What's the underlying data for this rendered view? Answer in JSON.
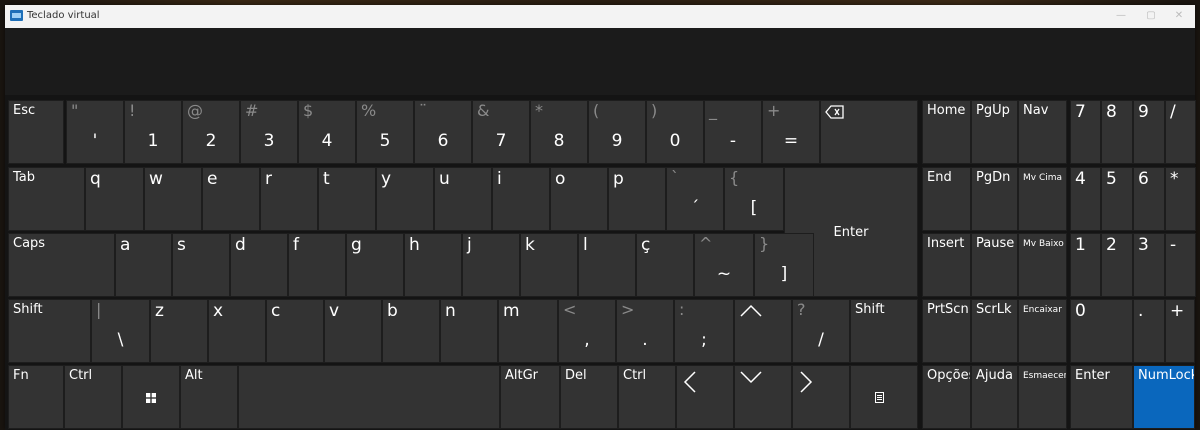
{
  "window": {
    "title": "Teclado virtual",
    "controls": [
      "—",
      "▢",
      "✕"
    ]
  },
  "main_keys": [
    {
      "name": "key-esc",
      "p": "Esc"
    },
    {
      "name": "key-quote",
      "s": "\"",
      "m": "'"
    },
    {
      "name": "key-1",
      "s": "!",
      "m": "1"
    },
    {
      "name": "key-2",
      "s": "@",
      "m": "2"
    },
    {
      "name": "key-3",
      "s": "#",
      "m": "3"
    },
    {
      "name": "key-4",
      "s": "$",
      "m": "4"
    },
    {
      "name": "key-5",
      "s": "%",
      "m": "5"
    },
    {
      "name": "key-6",
      "s": "¨",
      "m": "6"
    },
    {
      "name": "key-7",
      "s": "&",
      "m": "7"
    },
    {
      "name": "key-8",
      "s": "*",
      "m": "8"
    },
    {
      "name": "key-9",
      "s": "(",
      "m": "9"
    },
    {
      "name": "key-0",
      "s": ")",
      "m": "0"
    },
    {
      "name": "key-minus",
      "s": "_",
      "m": "-"
    },
    {
      "name": "key-equals",
      "s": "+",
      "m": "="
    },
    {
      "name": "key-backspace",
      "icon": "backspace-icon"
    },
    {
      "name": "key-tab",
      "p": "Tab"
    },
    {
      "name": "key-q",
      "p": "q",
      "big": true
    },
    {
      "name": "key-w",
      "p": "w",
      "big": true
    },
    {
      "name": "key-e",
      "p": "e",
      "big": true
    },
    {
      "name": "key-r",
      "p": "r",
      "big": true
    },
    {
      "name": "key-t",
      "p": "t",
      "big": true
    },
    {
      "name": "key-y",
      "p": "y",
      "big": true
    },
    {
      "name": "key-u",
      "p": "u",
      "big": true
    },
    {
      "name": "key-i",
      "p": "i",
      "big": true
    },
    {
      "name": "key-o",
      "p": "o",
      "big": true
    },
    {
      "name": "key-p",
      "p": "p",
      "big": true
    },
    {
      "name": "key-acute",
      "s": "`",
      "m": "´"
    },
    {
      "name": "key-bracket-open",
      "s": "{",
      "m": "["
    },
    {
      "name": "key-enter",
      "c": "Enter"
    },
    {
      "name": "key-caps",
      "p": "Caps"
    },
    {
      "name": "key-a",
      "p": "a",
      "big": true
    },
    {
      "name": "key-s",
      "p": "s",
      "big": true
    },
    {
      "name": "key-d",
      "p": "d",
      "big": true
    },
    {
      "name": "key-f",
      "p": "f",
      "big": true
    },
    {
      "name": "key-g",
      "p": "g",
      "big": true
    },
    {
      "name": "key-h",
      "p": "h",
      "big": true
    },
    {
      "name": "key-j",
      "p": "j",
      "big": true
    },
    {
      "name": "key-k",
      "p": "k",
      "big": true
    },
    {
      "name": "key-l",
      "p": "l",
      "big": true
    },
    {
      "name": "key-cedilla",
      "p": "ç",
      "big": true
    },
    {
      "name": "key-tilde",
      "s": "^",
      "m": "~"
    },
    {
      "name": "key-bracket-close",
      "s": "}",
      "m": "]"
    },
    {
      "name": "key-shift-left",
      "p": "Shift"
    },
    {
      "name": "key-backslash",
      "s": "|",
      "m": "\\"
    },
    {
      "name": "key-z",
      "p": "z",
      "big": true
    },
    {
      "name": "key-x",
      "p": "x",
      "big": true
    },
    {
      "name": "key-c",
      "p": "c",
      "big": true
    },
    {
      "name": "key-v",
      "p": "v",
      "big": true
    },
    {
      "name": "key-b",
      "p": "b",
      "big": true
    },
    {
      "name": "key-n",
      "p": "n",
      "big": true
    },
    {
      "name": "key-m",
      "p": "m",
      "big": true
    },
    {
      "name": "key-comma",
      "s": "<",
      "m": ","
    },
    {
      "name": "key-period",
      "s": ">",
      "m": "."
    },
    {
      "name": "key-semicolon",
      "s": ":",
      "m": ";"
    },
    {
      "name": "key-up",
      "icon": "arrow-up-icon"
    },
    {
      "name": "key-slash",
      "s": "?",
      "m": "/"
    },
    {
      "name": "key-shift-right",
      "p": "Shift"
    },
    {
      "name": "key-fn",
      "p": "Fn"
    },
    {
      "name": "key-ctrl-left",
      "p": "Ctrl"
    },
    {
      "name": "key-windows",
      "icon": "windows-logo-icon"
    },
    {
      "name": "key-alt",
      "p": "Alt"
    },
    {
      "name": "key-space"
    },
    {
      "name": "key-altgr",
      "p": "AltGr"
    },
    {
      "name": "key-del",
      "p": "Del"
    },
    {
      "name": "key-ctrl-right",
      "p": "Ctrl"
    },
    {
      "name": "key-left",
      "icon": "arrow-left-icon"
    },
    {
      "name": "key-down",
      "icon": "arrow-down-icon"
    },
    {
      "name": "key-right",
      "icon": "arrow-right-icon"
    },
    {
      "name": "key-menu",
      "icon": "menu-icon"
    }
  ],
  "nav_keys": [
    {
      "name": "key-home",
      "p": "Home"
    },
    {
      "name": "key-pgup",
      "p": "PgUp"
    },
    {
      "name": "key-nav",
      "p": "Nav"
    },
    {
      "name": "key-end",
      "p": "End"
    },
    {
      "name": "key-pgdn",
      "p": "PgDn"
    },
    {
      "name": "key-mv-cima",
      "p": "Mv Cima",
      "sm": true
    },
    {
      "name": "key-insert",
      "p": "Insert"
    },
    {
      "name": "key-pause",
      "p": "Pause"
    },
    {
      "name": "key-mv-baixo",
      "p": "Mv Baixo",
      "sm": true
    },
    {
      "name": "key-prtscn",
      "p": "PrtScn"
    },
    {
      "name": "key-scrlk",
      "p": "ScrLk"
    },
    {
      "name": "key-encaixar",
      "p": "Encaixar",
      "sm": true
    },
    {
      "name": "key-opcoes",
      "p": "Opções"
    },
    {
      "name": "key-ajuda",
      "p": "Ajuda"
    },
    {
      "name": "key-esmaecer",
      "p": "Esmaecer",
      "sm": true
    }
  ],
  "numpad_keys": [
    {
      "name": "numpad-7",
      "p": "7",
      "big": true
    },
    {
      "name": "numpad-8",
      "p": "8",
      "big": true
    },
    {
      "name": "numpad-9",
      "p": "9",
      "big": true
    },
    {
      "name": "numpad-divide",
      "p": "/",
      "big": true
    },
    {
      "name": "numpad-4",
      "p": "4",
      "big": true
    },
    {
      "name": "numpad-5",
      "p": "5",
      "big": true
    },
    {
      "name": "numpad-6",
      "p": "6",
      "big": true
    },
    {
      "name": "numpad-multiply",
      "p": "*",
      "big": true
    },
    {
      "name": "numpad-1",
      "p": "1",
      "big": true
    },
    {
      "name": "numpad-2",
      "p": "2",
      "big": true
    },
    {
      "name": "numpad-3",
      "p": "3",
      "big": true
    },
    {
      "name": "numpad-minus",
      "p": "-",
      "big": true
    },
    {
      "name": "numpad-0",
      "p": "0",
      "big": true
    },
    {
      "name": "numpad-decimal",
      "p": ".",
      "big": true
    },
    {
      "name": "numpad-plus",
      "p": "+",
      "big": true
    },
    {
      "name": "numpad-enter",
      "p": "Enter"
    },
    {
      "name": "key-numlock",
      "p": "NumLock",
      "active": true
    }
  ],
  "colors": {
    "key": "#333333",
    "key_active": "#0a67bd",
    "background": "#141414"
  }
}
